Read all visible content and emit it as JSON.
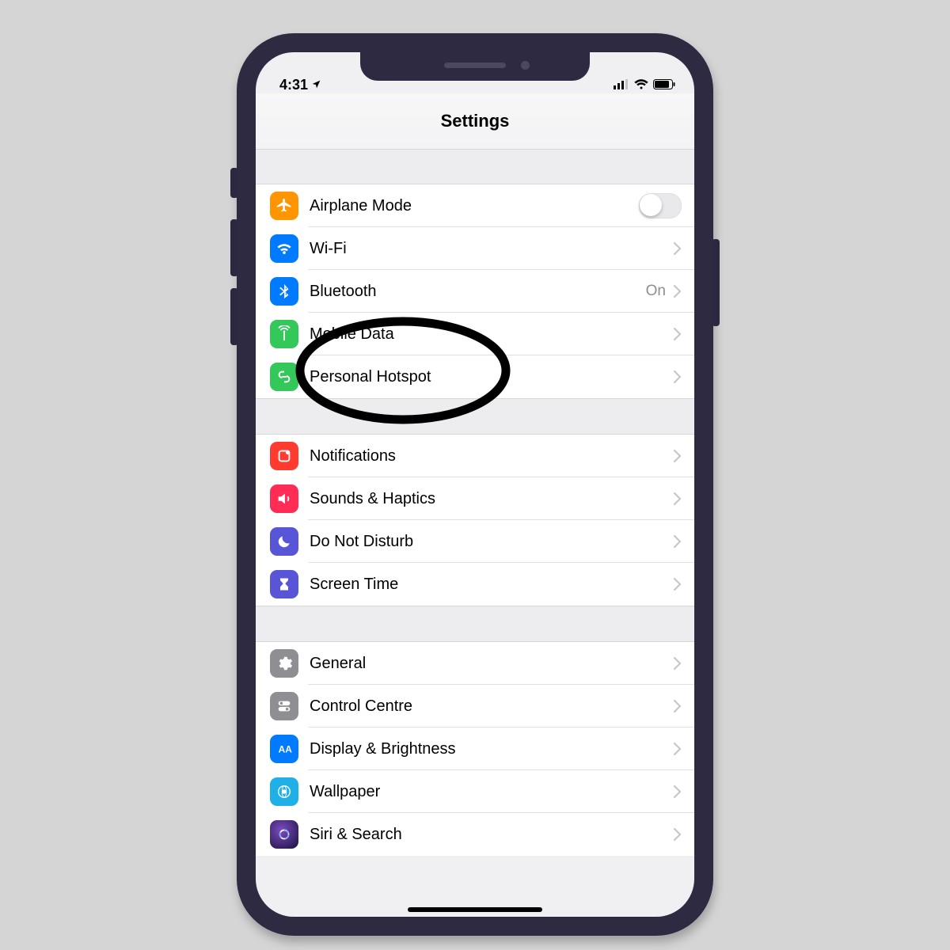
{
  "status": {
    "time": "4:31",
    "bluetooth_detail": "On"
  },
  "header": {
    "title": "Settings"
  },
  "rows": {
    "airplane": {
      "label": "Airplane Mode"
    },
    "wifi": {
      "label": "Wi-Fi"
    },
    "bluetooth": {
      "label": "Bluetooth"
    },
    "mobiledata": {
      "label": "Mobile Data"
    },
    "hotspot": {
      "label": "Personal Hotspot"
    },
    "notifications": {
      "label": "Notifications"
    },
    "sounds": {
      "label": "Sounds & Haptics"
    },
    "dnd": {
      "label": "Do Not Disturb"
    },
    "screentime": {
      "label": "Screen Time"
    },
    "general": {
      "label": "General"
    },
    "controlcentre": {
      "label": "Control Centre"
    },
    "display": {
      "label": "Display & Brightness"
    },
    "wallpaper": {
      "label": "Wallpaper"
    },
    "siri": {
      "label": "Siri & Search"
    }
  }
}
